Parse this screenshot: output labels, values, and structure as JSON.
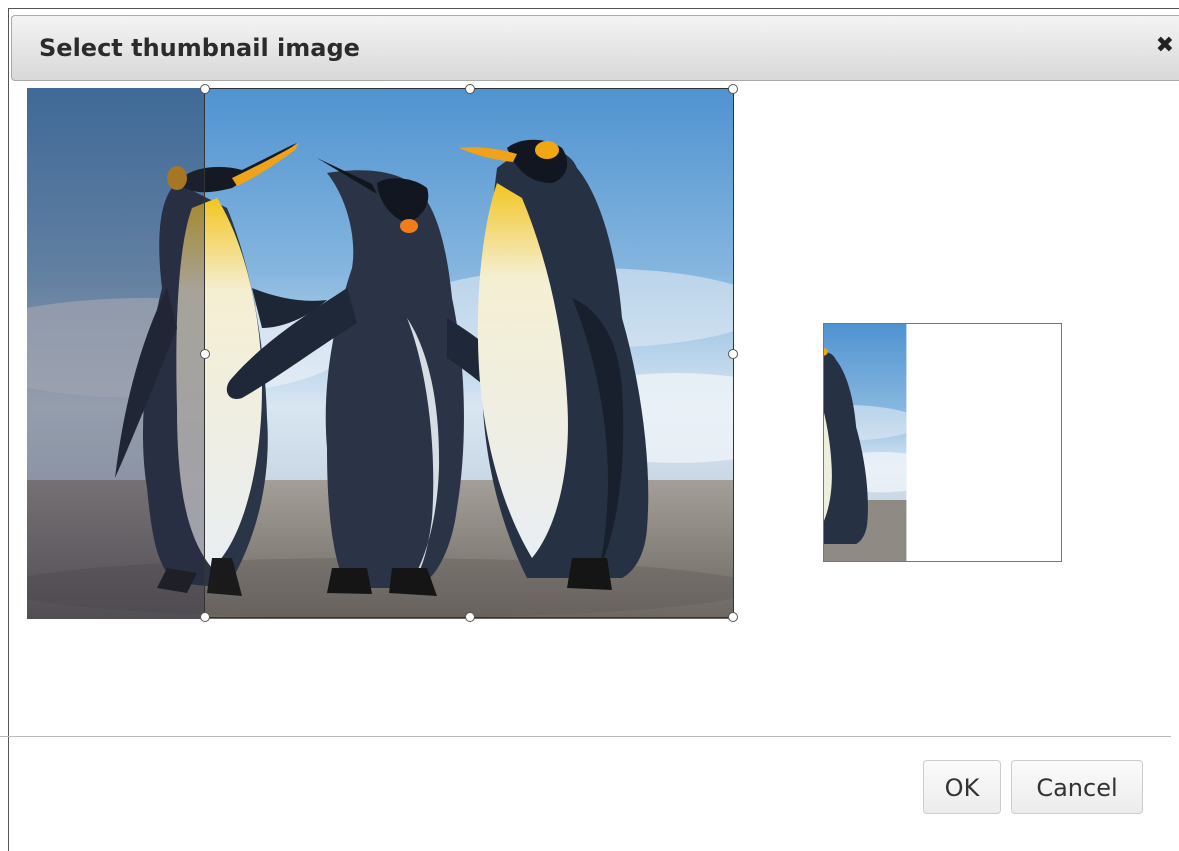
{
  "dialog": {
    "title": "Select thumbnail image",
    "close_glyph": "✖",
    "close_icon": "close-icon"
  },
  "image": {
    "subject": "three king penguins on a beach",
    "crop_selection": {
      "shape": "square",
      "handles": [
        "top-left",
        "top-center",
        "top-right",
        "middle-left",
        "middle-right",
        "bottom-left",
        "bottom-center",
        "bottom-right"
      ]
    }
  },
  "buttons": {
    "ok_label": "OK",
    "cancel_label": "Cancel"
  },
  "colors": {
    "titlebar_top": "#f4f4f4",
    "titlebar_bottom": "#d8d8d8",
    "sky": "#6fa7d8",
    "sand": "#8f8a84"
  }
}
